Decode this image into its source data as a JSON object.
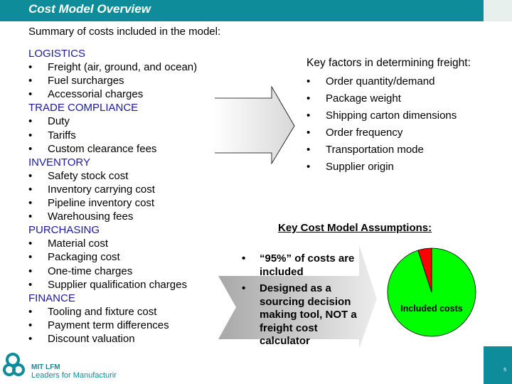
{
  "header": {
    "title": "Cost Model Overview"
  },
  "summary": "Summary of costs included in the model:",
  "categories": [
    {
      "name": "LOGISTICS",
      "items": [
        "Freight (air, ground, and ocean)",
        "Fuel surcharges",
        "Accessorial charges"
      ]
    },
    {
      "name": "TRADE COMPLIANCE",
      "items": [
        "Duty",
        "Tariffs",
        "Custom clearance fees"
      ]
    },
    {
      "name": "INVENTORY",
      "items": [
        "Safety stock cost",
        "Inventory carrying cost",
        "Pipeline inventory cost",
        "Warehousing fees"
      ]
    },
    {
      "name": "PURCHASING",
      "items": [
        "Material cost",
        "Packaging cost",
        "One-time charges",
        "Supplier qualification charges"
      ]
    },
    {
      "name": "FINANCE",
      "items": [
        "Tooling and fixture cost",
        "Payment term differences",
        "Discount valuation"
      ]
    }
  ],
  "key_factors": {
    "title": "Key factors in determining freight:",
    "items": [
      "Order quantity/demand",
      "Package weight",
      "Shipping carton dimensions",
      "Order frequency",
      "Transportation mode",
      "Supplier origin"
    ]
  },
  "assumptions": {
    "title": "Key Cost Model Assumptions:",
    "items": [
      "“95%” of costs are included",
      "Designed as a sourcing decision making tool, NOT a freight cost calculator"
    ]
  },
  "chart_data": {
    "type": "pie",
    "slices": [
      {
        "label": "Included costs",
        "value": 95,
        "color": "#00ff00"
      },
      {
        "value": 5,
        "color": "#ff0000"
      }
    ]
  },
  "footer": {
    "logo_line1": "MIT LFM",
    "logo_line2": "Leaders for Manufacturing",
    "page_number": "5"
  },
  "colors": {
    "header": "#0f8c99",
    "heading": "#1a1a9c"
  }
}
